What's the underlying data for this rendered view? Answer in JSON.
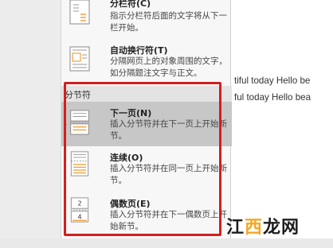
{
  "document": {
    "line1": "tiful today Hello be",
    "line2": "ful today Hello bea"
  },
  "menu": {
    "items_top": [
      {
        "title": "分栏符(C)",
        "desc": "指示分栏符后面的文字将从下一栏开始。",
        "icon": "column-break-icon"
      },
      {
        "title": "自动换行符(T)",
        "desc": "分隔网页上的对象周围的文字，如分隔题注文字与正文。",
        "icon": "text-wrapping-break-icon"
      }
    ],
    "section_header": "分节符",
    "section_items": [
      {
        "title": "下一页(N)",
        "desc": "插入分节符并在下一页上开始新节。",
        "icon": "next-page-break-icon",
        "active": true
      },
      {
        "title": "连续(O)",
        "desc": "插入分节符并在同一页上开始新节。",
        "icon": "continuous-break-icon",
        "active": false
      },
      {
        "title": "偶数页(E)",
        "desc": "插入分节符并在下一偶数页上开始新节。",
        "icon": "even-page-break-icon",
        "icon_labels": [
          "2",
          "4"
        ],
        "active": false
      }
    ]
  },
  "watermark": {
    "part1": "江",
    "part2": "西",
    "part3": "龙网"
  },
  "colors": {
    "highlight_border": "#d21f1f",
    "icon_orange": "#f0a23c",
    "active_bg": "#c7c7c7",
    "title_bar_blue": "#2b5797"
  }
}
